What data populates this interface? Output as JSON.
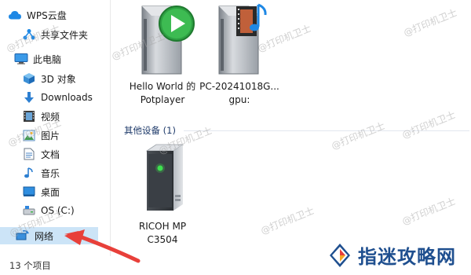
{
  "nav": {
    "items": [
      {
        "label": "WPS云盘",
        "icon": "cloud-icon"
      },
      {
        "label": "共享文件夹",
        "icon": "share-icon"
      },
      {
        "label": "此电脑",
        "icon": "computer-icon"
      },
      {
        "label": "3D 对象",
        "icon": "cube-icon"
      },
      {
        "label": "Downloads",
        "icon": "download-arrow-icon"
      },
      {
        "label": "视频",
        "icon": "video-icon"
      },
      {
        "label": "图片",
        "icon": "picture-icon"
      },
      {
        "label": "文档",
        "icon": "document-icon"
      },
      {
        "label": "音乐",
        "icon": "music-icon"
      },
      {
        "label": "桌面",
        "icon": "desktop-icon"
      },
      {
        "label": "OS (C:)",
        "icon": "drive-icon"
      },
      {
        "label": "网络",
        "icon": "network-icon"
      }
    ],
    "selected": "网络"
  },
  "status": {
    "item_count": "13 个项目"
  },
  "main": {
    "media_servers": [
      {
        "label_line1": "Hello World 的",
        "label_line2": "Potplayer",
        "icon": "play-media-server-icon"
      },
      {
        "label_line1": "PC-20241018G...",
        "label_line2": "gpu:",
        "icon": "music-media-server-icon"
      }
    ],
    "group_header": "其他设备 (1)",
    "devices": [
      {
        "label_line1": "RICOH MP",
        "label_line2": "C3504",
        "icon": "network-device-icon"
      }
    ]
  },
  "watermark": "@打印机卫士",
  "brand": {
    "text": "指迷攻略网",
    "logo": "brand-diamond-logo-icon"
  },
  "colors": {
    "selection": "#cce4f7",
    "accent": "#1e88e5",
    "arrow": "#e8403a",
    "play_green": "#2ea043"
  }
}
